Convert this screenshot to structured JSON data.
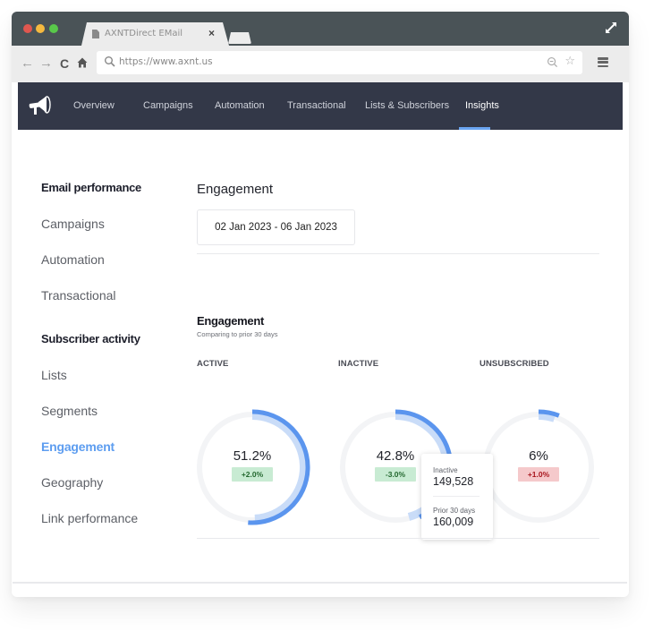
{
  "browser": {
    "tab_title": "AXNTDirect EMail",
    "tab_close": "×",
    "url": "https://www.axnt.us",
    "back": "←",
    "forward": "→",
    "reload": "C",
    "home": "⌂",
    "star": "☆"
  },
  "app_nav": {
    "items": [
      {
        "label": "Overview"
      },
      {
        "label": "Campaigns"
      },
      {
        "label": "Automation"
      },
      {
        "label": "Transactional"
      },
      {
        "label": "Lists & Subscribers"
      },
      {
        "label": "Insights",
        "active": true
      }
    ],
    "accent": "#6aa5f2",
    "background": "#333848"
  },
  "sidebar": {
    "sections": [
      {
        "heading": "Email performance",
        "items": [
          {
            "label": "Campaigns"
          },
          {
            "label": "Automation"
          },
          {
            "label": "Transactional"
          }
        ]
      },
      {
        "heading": "Subscriber activity",
        "items": [
          {
            "label": "Lists"
          },
          {
            "label": "Segments"
          },
          {
            "label": "Engagement",
            "active": true
          },
          {
            "label": "Geography"
          },
          {
            "label": "Link performance"
          }
        ]
      }
    ],
    "active_color": "#5d9df0"
  },
  "main": {
    "title": "Engagement",
    "date_range": "02 Jan 2023 - 06 Jan 2023",
    "section": {
      "title": "Engagement",
      "subtitle": "Comparing to prior 30 days"
    },
    "tooltip": {
      "label1": "Inactive",
      "value1": "149,528",
      "label2": "Prior 30 days",
      "value2": "160,009"
    }
  },
  "chart_data": {
    "type": "pie",
    "title": "Engagement",
    "subtitle": "Comparing to prior 30 days",
    "series": [
      {
        "name": "ACTIVE",
        "value_pct": 51.2,
        "display": "51.2%",
        "delta": "+2.0%",
        "delta_status": "good",
        "prior_pct": 49.2
      },
      {
        "name": "INACTIVE",
        "value_pct": 42.8,
        "display": "42.8%",
        "delta": "-3.0%",
        "delta_status": "good",
        "prior_pct": 45.8,
        "count": 149528,
        "prior_count": 160009
      },
      {
        "name": "UNSUBSCRIBED",
        "value_pct": 6,
        "display": "6%",
        "delta": "+1.0%",
        "delta_status": "bad",
        "prior_pct": 5
      }
    ],
    "colors": {
      "current": "#5b95ee",
      "prior": "#c9dcf8",
      "track": "#f3f4f6",
      "good_bg": "#c8ebd3",
      "bad_bg": "#f5c9cb"
    }
  }
}
